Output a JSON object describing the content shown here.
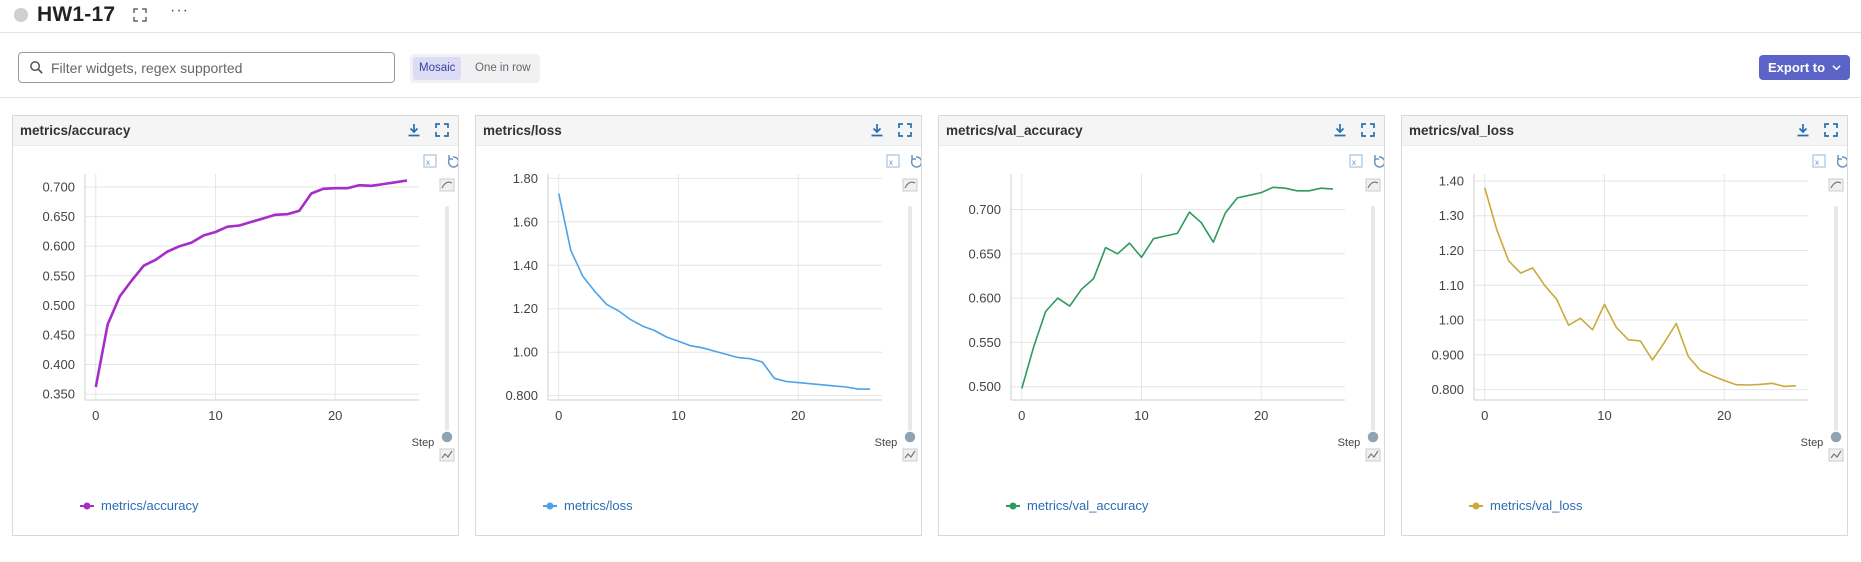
{
  "header": {
    "title": "HW1-17"
  },
  "toolbar": {
    "filter_placeholder": "Filter widgets, regex supported",
    "view_options": [
      "Mosaic",
      "One in row"
    ],
    "active_view": "Mosaic",
    "export_label": "Export to"
  },
  "colors": {
    "accent": "#5b63c7",
    "accuracy": "#a52ec9",
    "loss": "#4aa3ea",
    "val_accuracy": "#2e9a5d",
    "val_loss": "#c9aa3a"
  },
  "panels": [
    {
      "title": "metrics/accuracy",
      "legend": "metrics/accuracy",
      "color": "#a52ec9",
      "step_label": "Step"
    },
    {
      "title": "metrics/loss",
      "legend": "metrics/loss",
      "color": "#4aa3ea",
      "step_label": "Step"
    },
    {
      "title": "metrics/val_accuracy",
      "legend": "metrics/val_accuracy",
      "color": "#2e9a5d",
      "step_label": "Step"
    },
    {
      "title": "metrics/val_loss",
      "legend": "metrics/val_loss",
      "color": "#c9aa3a",
      "step_label": "Step"
    }
  ],
  "chart_data": [
    {
      "type": "line",
      "title": "metrics/accuracy",
      "xlabel": "Step",
      "ylabel": "",
      "x": [
        0,
        1,
        2,
        3,
        4,
        5,
        6,
        7,
        8,
        9,
        10,
        11,
        12,
        13,
        14,
        15,
        16,
        17,
        18,
        19,
        20,
        21,
        22,
        23,
        24,
        25,
        26
      ],
      "series": [
        {
          "name": "metrics/accuracy",
          "values": [
            0.362,
            0.468,
            0.515,
            0.542,
            0.567,
            0.577,
            0.591,
            0.6,
            0.606,
            0.618,
            0.624,
            0.633,
            0.635,
            0.641,
            0.647,
            0.653,
            0.654,
            0.66,
            0.689,
            0.697,
            0.698,
            0.698,
            0.703,
            0.702,
            0.705,
            0.708,
            0.711
          ]
        }
      ],
      "xlim": [
        -0.9,
        27
      ],
      "ylim": [
        0.34,
        0.722
      ],
      "xticks": [
        "0",
        "10",
        "20"
      ],
      "yticks": [
        "0.350",
        "0.400",
        "0.450",
        "0.500",
        "0.550",
        "0.600",
        "0.650",
        "0.700"
      ],
      "grid": true,
      "legend": "bottom-left"
    },
    {
      "type": "line",
      "title": "metrics/loss",
      "xlabel": "Step",
      "ylabel": "",
      "x": [
        0,
        1,
        2,
        3,
        4,
        5,
        6,
        7,
        8,
        9,
        10,
        11,
        12,
        13,
        14,
        15,
        16,
        17,
        18,
        19,
        20,
        21,
        22,
        23,
        24,
        25,
        26
      ],
      "series": [
        {
          "name": "metrics/loss",
          "values": [
            1.73,
            1.47,
            1.35,
            1.28,
            1.22,
            1.19,
            1.15,
            1.12,
            1.1,
            1.07,
            1.05,
            1.03,
            1.02,
            1.005,
            0.99,
            0.975,
            0.97,
            0.955,
            0.88,
            0.865,
            0.86,
            0.855,
            0.85,
            0.845,
            0.84,
            0.83,
            0.83
          ]
        }
      ],
      "xlim": [
        -0.9,
        27
      ],
      "ylim": [
        0.78,
        1.82
      ],
      "xticks": [
        "0",
        "10",
        "20"
      ],
      "yticks": [
        "0.800",
        "1.00",
        "1.20",
        "1.40",
        "1.60",
        "1.80"
      ],
      "grid": true,
      "legend": "bottom-left"
    },
    {
      "type": "line",
      "title": "metrics/val_accuracy",
      "xlabel": "Step",
      "ylabel": "",
      "x": [
        0,
        1,
        2,
        3,
        4,
        5,
        6,
        7,
        8,
        9,
        10,
        11,
        12,
        13,
        14,
        15,
        16,
        17,
        18,
        19,
        20,
        21,
        22,
        23,
        24,
        25,
        26
      ],
      "series": [
        {
          "name": "metrics/val_accuracy",
          "values": [
            0.498,
            0.545,
            0.585,
            0.6,
            0.591,
            0.61,
            0.622,
            0.657,
            0.65,
            0.662,
            0.646,
            0.667,
            0.67,
            0.673,
            0.697,
            0.685,
            0.663,
            0.696,
            0.713,
            0.716,
            0.719,
            0.725,
            0.724,
            0.721,
            0.721,
            0.724,
            0.723
          ]
        }
      ],
      "xlim": [
        -0.9,
        27
      ],
      "ylim": [
        0.485,
        0.74
      ],
      "xticks": [
        "0",
        "10",
        "20"
      ],
      "yticks": [
        "0.500",
        "0.550",
        "0.600",
        "0.650",
        "0.700"
      ],
      "grid": true,
      "legend": "bottom-left"
    },
    {
      "type": "line",
      "title": "metrics/val_loss",
      "xlabel": "Step",
      "ylabel": "",
      "x": [
        0,
        1,
        2,
        3,
        4,
        5,
        6,
        7,
        8,
        9,
        10,
        11,
        12,
        13,
        14,
        15,
        16,
        17,
        18,
        19,
        20,
        21,
        22,
        23,
        24,
        25,
        26
      ],
      "series": [
        {
          "name": "metrics/val_loss",
          "values": [
            1.38,
            1.26,
            1.17,
            1.135,
            1.15,
            1.1,
            1.06,
            0.985,
            1.005,
            0.972,
            1.045,
            0.978,
            0.943,
            0.94,
            0.885,
            0.935,
            0.99,
            0.895,
            0.855,
            0.84,
            0.826,
            0.814,
            0.813,
            0.815,
            0.818,
            0.809,
            0.811
          ]
        }
      ],
      "xlim": [
        -0.9,
        27
      ],
      "ylim": [
        0.77,
        1.42
      ],
      "xticks": [
        "0",
        "10",
        "20"
      ],
      "yticks": [
        "0.800",
        "0.900",
        "1.00",
        "1.10",
        "1.20",
        "1.30",
        "1.40"
      ],
      "grid": true,
      "legend": "bottom-left"
    }
  ]
}
